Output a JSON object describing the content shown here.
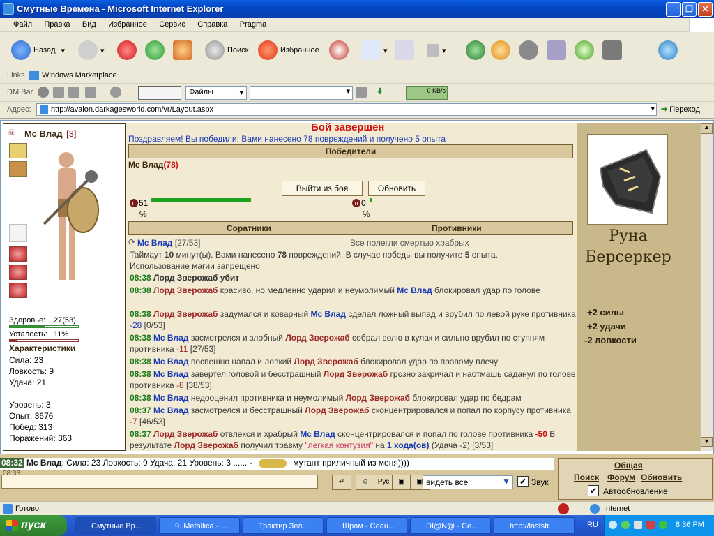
{
  "window": {
    "title": "Смутные Времена - Microsoft Internet Explorer"
  },
  "menu": [
    "Файл",
    "Правка",
    "Вид",
    "Избранное",
    "Сервис",
    "Справка",
    "Pragma"
  ],
  "toolbar": {
    "back": "Назад",
    "search": "Поиск",
    "favorites": "Избранное"
  },
  "links": {
    "label": "Links",
    "item": "Windows Marketplace"
  },
  "dmbar": {
    "label": "DM Bar",
    "files": "Файлы",
    "speed": "0 KB/s"
  },
  "address": {
    "label": "Адрес:",
    "url": "http://avalon.darkagesworld.com/vr/Layout.aspx",
    "go": "Переход"
  },
  "player": {
    "name": "Мс Влад",
    "level": "[3]",
    "health_label": "Здоровье:",
    "health": "27(53)",
    "fatigue_label": "Усталость:",
    "fatigue": "11%",
    "stats_title": "Характеристики",
    "strength": "Сила: 23",
    "agility": "Ловкость: 9",
    "luck": "Удача: 21",
    "level_line": "Уровень: 3",
    "exp": "Опыт: 3676",
    "wins": "Побед: 313",
    "losses": "Поражений: 363",
    "health_pct": 51,
    "fatigue_pct": 11
  },
  "battle": {
    "title": "Бой завершен",
    "congrats": "Поздравляем! Вы победили. Вами нанесено 78 повреждений и получено 5 опыта",
    "winners_header": "Победители",
    "winner": "Мс Влад",
    "winner_score": "(78)",
    "exit_btn": "Выйти из боя",
    "refresh_btn": "Обновить",
    "left_pct": "51",
    "right_pct": "0",
    "pct": "%",
    "allies_header": "Соратники",
    "enemies_header": "Противники",
    "ally_name": "Мс Влад",
    "ally_hp": "[27/53]",
    "enemies_note": "Все полегли смертью храбрых",
    "timeout_a": "Таймаут ",
    "timeout_b": "10",
    "timeout_c": " минут(ы). Вами нанесено ",
    "timeout_d": "78",
    "timeout_e": " повреждений. В случае победы вы получите ",
    "timeout_f": "5",
    "timeout_g": " опыта.",
    "magic": "Использование магии запрещено"
  },
  "log": [
    {
      "time": "08:38",
      "a": "Лорд Зверожаб убит"
    },
    {
      "time": "08:38",
      "a": "Лорд Зверожаб",
      "b": " красиво, но медленно ударил и неумолимый ",
      "c": "Мс Влад",
      "d": " блокировал удар по голове"
    },
    {
      "time": "08:38",
      "a": "Лорд Зверожаб",
      "b": " задумался и коварный ",
      "c": "Мс Влад",
      "d": " сделал ложный выпад и врубил по левой руке противника ",
      "e": "-28",
      "f": " [0/53]"
    },
    {
      "time": "08:38",
      "a": "Мс Влад",
      "b": " засмотрелся и злобный ",
      "c": "Лорд Зверожаб",
      "d": " собрал волю в кулак и сильно врубил по ступням противника ",
      "e": "-11",
      "f": " [27/53]"
    },
    {
      "time": "08:38",
      "a": "Мс Влад",
      "b": " поспешно напал и ловкий ",
      "c": "Лорд Зверожаб",
      "d": " блокировал удар по правому плечу"
    },
    {
      "time": "08:38",
      "a": "Мс Влад",
      "b": " завертел головой и бесстрашный ",
      "c": "Лорд Зверожаб",
      "d": " грозно закричал и наотмашь саданул по голове противника ",
      "e": "-8",
      "f": " [38/53]"
    },
    {
      "time": "08:38",
      "a": "Мс Влад",
      "b": " недооценил противника и неумолимый ",
      "c": "Лорд Зверожаб",
      "d": " блокировал удар по бедрам"
    },
    {
      "time": "08:37",
      "a": "Мс Влад",
      "b": " засмотрелся и бесстрашный ",
      "c": "Лорд Зверожаб",
      "d": " сконцентрировался и попал по корпусу противника ",
      "e": "-7",
      "f": " [46/53]"
    },
    {
      "time": "08:37",
      "a": "Лорд Зверожаб",
      "b": " отвлекся и храбрый ",
      "c": "Мс Влад",
      "d": " сконцентрировался и попал по голове противника ",
      "e": "-50",
      "g": " В результате ",
      "h": "Лорд Зверожаб",
      "i": " получил травму ",
      "j": "\"легкая контузия\"",
      "k": " на ",
      "l": "1 хода(ов)",
      "m": " (Удача -2) [3/53]"
    }
  ],
  "rune": {
    "name1": "Руна",
    "name2": "Берсеркер",
    "b1": "+2 силы",
    "b2": "+2 удачи",
    "b3": "-2 ловкости"
  },
  "chat": {
    "time": "08:32",
    "name": "Мс Влад",
    "text": ": Сила: 23 Ловкость: 9 Удача: 21 Уровень: 3 ...... -",
    "msg": "мутант приличный из меня))))",
    "second_time": "08:33",
    "filter": "видеть все",
    "sound": "Звук"
  },
  "rightlinks": {
    "general": "Общая",
    "search": "Поиск",
    "forum": "Форум",
    "refresh": "Обновить",
    "auto": "Автообновление"
  },
  "status": {
    "done": "Готово",
    "zone": "Internet"
  },
  "taskbar": {
    "start": "пуск",
    "tasks": [
      "Смутные Вр...",
      "9. Metallica - ...",
      "Трактир Зел...",
      "Шрам - Сеан...",
      "DI@N@ - Се...",
      "http://laststr..."
    ],
    "lang": "RU",
    "clock": "8:36 PM"
  }
}
